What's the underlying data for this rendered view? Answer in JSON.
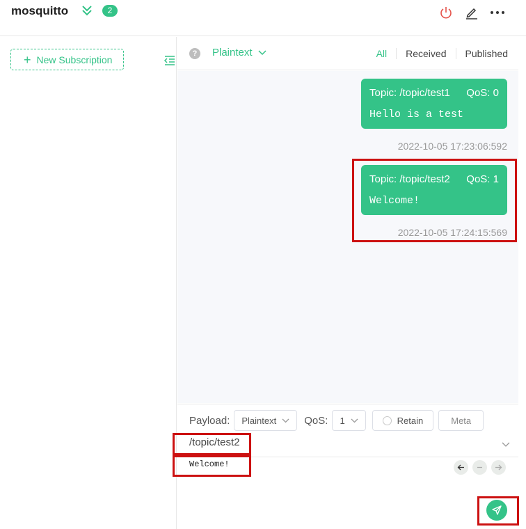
{
  "header": {
    "connection_name": "mosquitto",
    "badge_count": "2",
    "icons": [
      "chevron-double-down-icon",
      "power-icon",
      "edit-icon",
      "more-icon"
    ]
  },
  "sidebar": {
    "new_subscription_label": "New Subscription"
  },
  "toolbar": {
    "help": "?",
    "format": "Plaintext",
    "filters": [
      {
        "label": "All",
        "active": true
      },
      {
        "label": "Received",
        "active": false
      },
      {
        "label": "Published",
        "active": false
      }
    ]
  },
  "messages": [
    {
      "topic": "Topic: /topic/test1",
      "qos": "QoS: 0",
      "payload": "Hello is a test",
      "time": "2022-10-05 17:23:06:592"
    },
    {
      "topic": "Topic: /topic/test2",
      "qos": "QoS: 1",
      "payload": "Welcome!",
      "time": "2022-10-05 17:24:15:569"
    }
  ],
  "publish": {
    "payload_label": "Payload:",
    "payload_format": "Plaintext",
    "qos_label": "QoS:",
    "qos_value": "1",
    "retain_label": "Retain",
    "meta_label": "Meta",
    "topic": "/topic/test2",
    "payload": "Welcome!"
  },
  "colors": {
    "accent": "#34c388",
    "highlight": "#cc1111",
    "power": "#e5534b"
  }
}
